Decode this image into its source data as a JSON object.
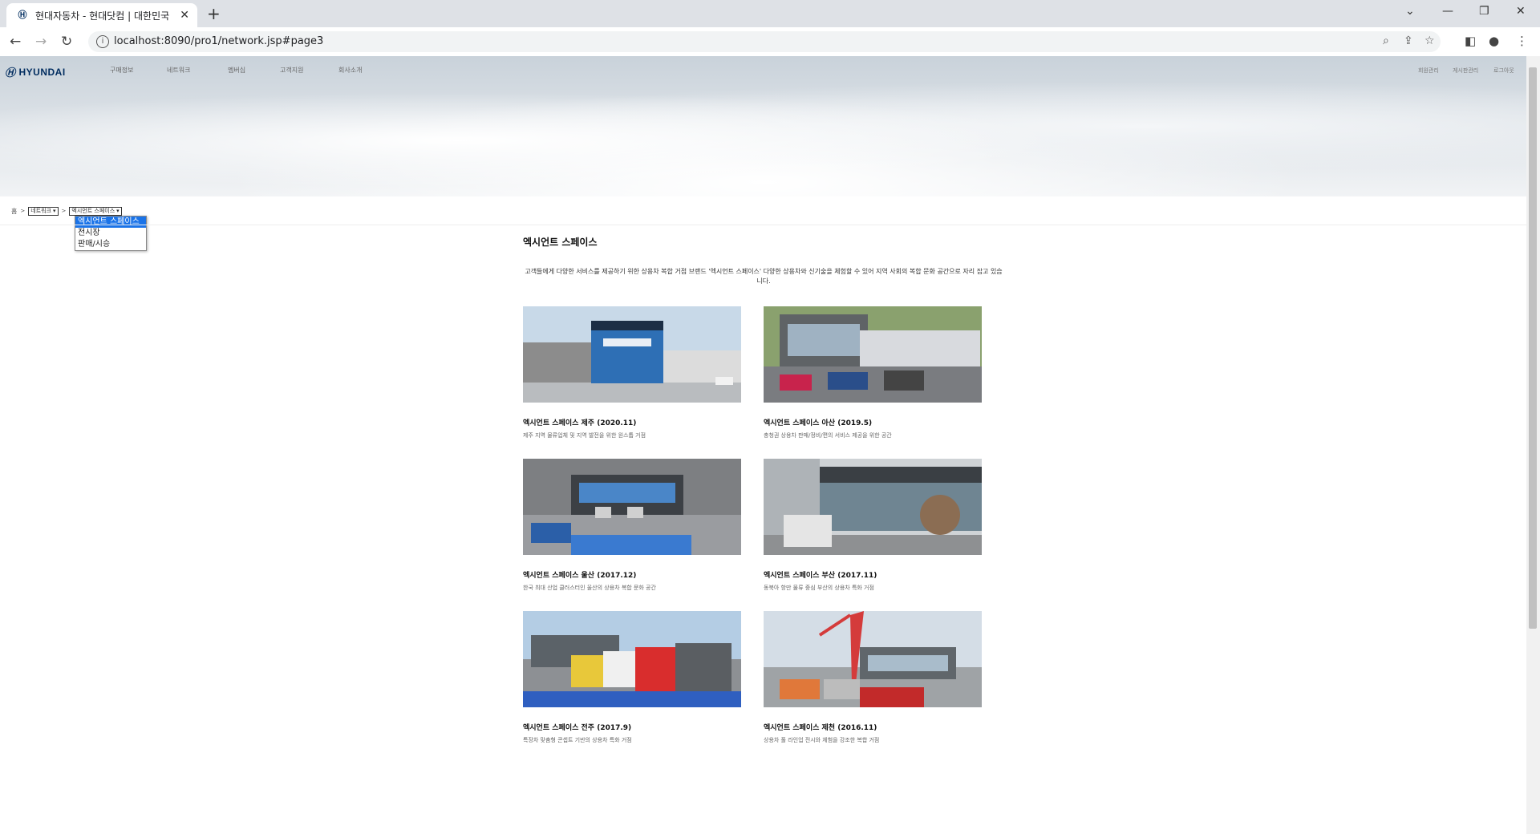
{
  "browser": {
    "tab_title": "현대자동차 - 현대닷컴 | 대한민국",
    "tab_close": "✕",
    "new_tab": "+",
    "url": "localhost:8090/pro1/network.jsp#page3"
  },
  "header": {
    "logo_text": "HYUNDAI",
    "gnb": [
      "구매정보",
      "네트워크",
      "멤버십",
      "고객지원",
      "회사소개"
    ],
    "util": [
      "회원관리",
      "게시판관리",
      "로그아웃"
    ]
  },
  "breadcrumb": {
    "home": "홈",
    "level1": "네트워크",
    "level2": "엑시언트 스페이스",
    "dropdown_options": [
      "엑시언트 스페이스",
      "전시장",
      "판매/시승"
    ]
  },
  "content": {
    "title": "엑시언트 스페이스",
    "description": "고객들에게 다양한 서비스를 제공하기 위한 상용차 복합 거점 브랜드 '엑시언트 스페이스' 다양한 상용차와 신기술을 체험할 수 있어 지역 사회의 복합 문화 공간으로 자리 잡고 있습니다.",
    "cards": [
      {
        "title": "엑시언트 스페이스 제주 (2020.11)",
        "desc": "제주 지역 물류업체 및 지역 발전을 위한 원스톱 거점"
      },
      {
        "title": "엑시언트 스페이스 아산 (2019.5)",
        "desc": "충청권 상용차 판매/정비/편의 서비스 제공을 위한 공간"
      },
      {
        "title": "엑시언트 스페이스 울산 (2017.12)",
        "desc": "한국 최대 산업 클러스터인 울산의 상용차 복합 문화 공간"
      },
      {
        "title": "엑시언트 스페이스 부산 (2017.11)",
        "desc": "동북아 항만 물류 중심 부산의 상용차 특화 거점"
      },
      {
        "title": "엑시언트 스페이스 전주 (2017.9)",
        "desc": "특장차 맞춤형 콘셉트 기반의 상용차 특화 거점"
      },
      {
        "title": "엑시언트 스페이스 제천 (2016.11)",
        "desc": "상용차 풀 라인업 전시와 체험을 강조한 복합 거점"
      }
    ]
  }
}
